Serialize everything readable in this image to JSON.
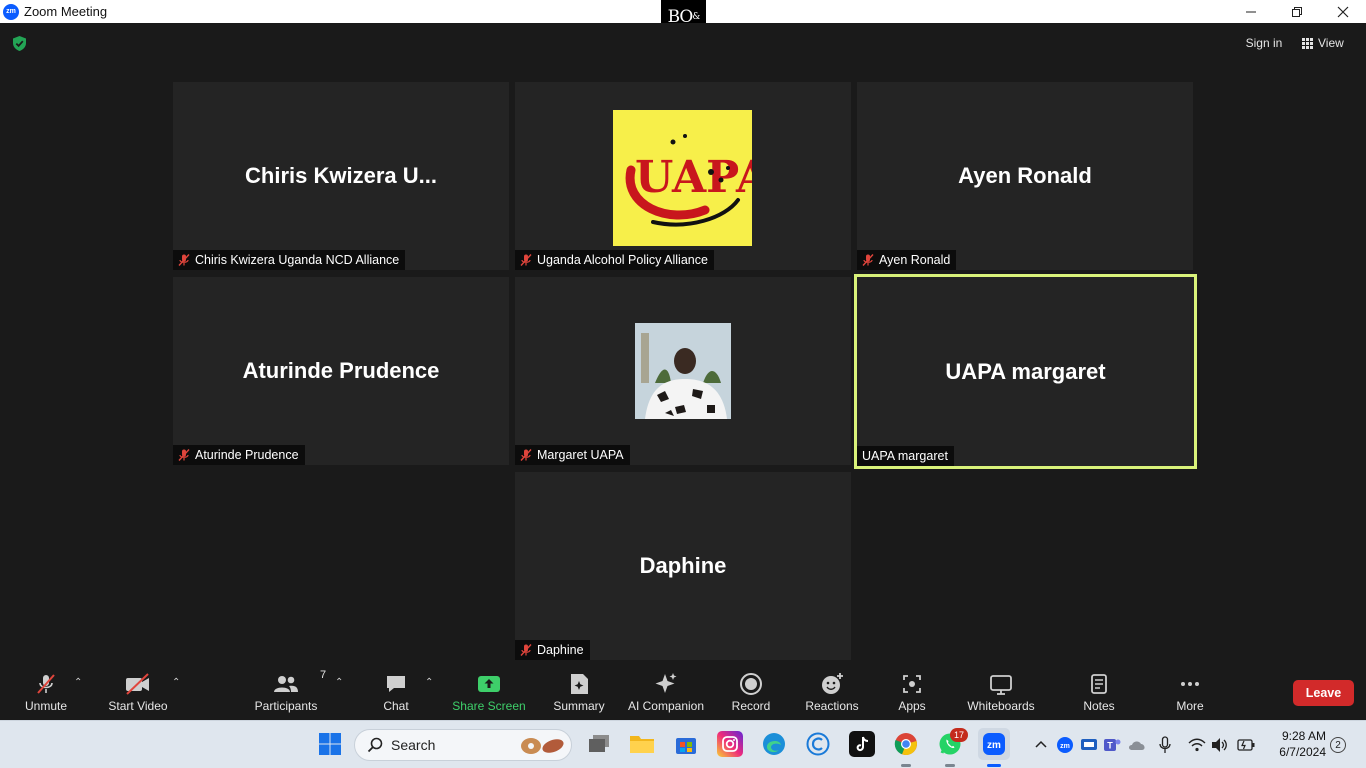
{
  "window": {
    "app_icon": "zm",
    "title": "Zoom Meeting",
    "controls": [
      "minimize-icon",
      "restore-icon",
      "close-icon"
    ]
  },
  "brand_badge": {
    "text": "BO",
    "superscript": "&"
  },
  "topbar": {
    "security_icon": "shield-check-icon",
    "sign_in": "Sign in",
    "view": "View"
  },
  "tiles": [
    {
      "display_name": "Chiris  Kwizera U...",
      "label": "Chiris  Kwizera Uganda NCD Alliance",
      "muted": true
    },
    {
      "display_name": "",
      "label": "Uganda Alcohol Policy Alliance",
      "muted": true,
      "logo_text": "UAPA"
    },
    {
      "display_name": "Ayen Ronald",
      "label": "Ayen Ronald",
      "muted": true
    },
    {
      "display_name": "Aturinde Prudence",
      "label": "Aturinde Prudence",
      "muted": true
    },
    {
      "display_name": "",
      "label": "Margaret UAPA",
      "muted": true
    },
    {
      "display_name": "UAPA margaret",
      "label": "UAPA margaret",
      "muted": false,
      "active_speaker": true
    },
    {
      "display_name": "Daphine",
      "label": "Daphine",
      "muted": true
    }
  ],
  "toolbar": {
    "unmute": "Unmute",
    "start_video": "Start Video",
    "participants": "Participants",
    "participants_count": "7",
    "chat": "Chat",
    "share_screen": "Share Screen",
    "summary": "Summary",
    "ai_companion": "AI Companion",
    "record": "Record",
    "reactions": "Reactions",
    "apps": "Apps",
    "whiteboards": "Whiteboards",
    "notes": "Notes",
    "more": "More",
    "leave": "Leave"
  },
  "taskbar": {
    "search": "Search",
    "whatsapp_badge": "17",
    "time": "9:28 AM",
    "date": "6/7/2024",
    "notifications": "2"
  },
  "colors": {
    "active_speaker_border": "#d9f27a",
    "share_screen_green": "#3ecf6a",
    "leave_red": "#d22a2a",
    "zoom_blue": "#0b5cff"
  }
}
